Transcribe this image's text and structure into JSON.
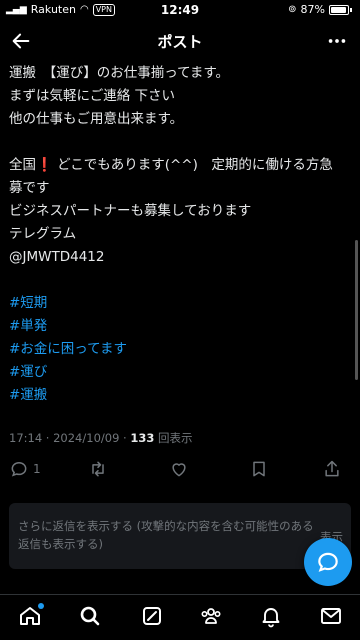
{
  "status_bar": {
    "carrier": "Rakuten",
    "vpn": "VPN",
    "time": "12:49",
    "battery": "87%"
  },
  "header": {
    "title": "ポスト"
  },
  "post": {
    "lines": [
      "運搬　【運び】のお仕事揃ってます。",
      "まずは気軽にご連絡 下さい",
      "他の仕事もご用意出来ます。",
      "",
      "全国❗ どこでもあります(^^)　定期的に働ける方急",
      "募です",
      "ビジネスパートナーも募集しております",
      "テレグラム",
      "@JMWTD4412",
      ""
    ],
    "hashtags": [
      "#短期",
      "#単発",
      "#お金に困ってます",
      "#運び",
      "#運搬"
    ],
    "timestamp": "17:14 · 2024/10/09 · ",
    "views_count": "133",
    "views_label": " 回表示"
  },
  "actions": {
    "reply_count": "1",
    "retweet_count": "",
    "like_count": ""
  },
  "reply_notice": {
    "text": "さらに返信を表示する (攻撃的な内容を含む可能性のある返信も表示する)",
    "button": "表示"
  },
  "colors": {
    "accent": "#1d9bf0",
    "muted": "#71767b",
    "background": "#000000"
  }
}
